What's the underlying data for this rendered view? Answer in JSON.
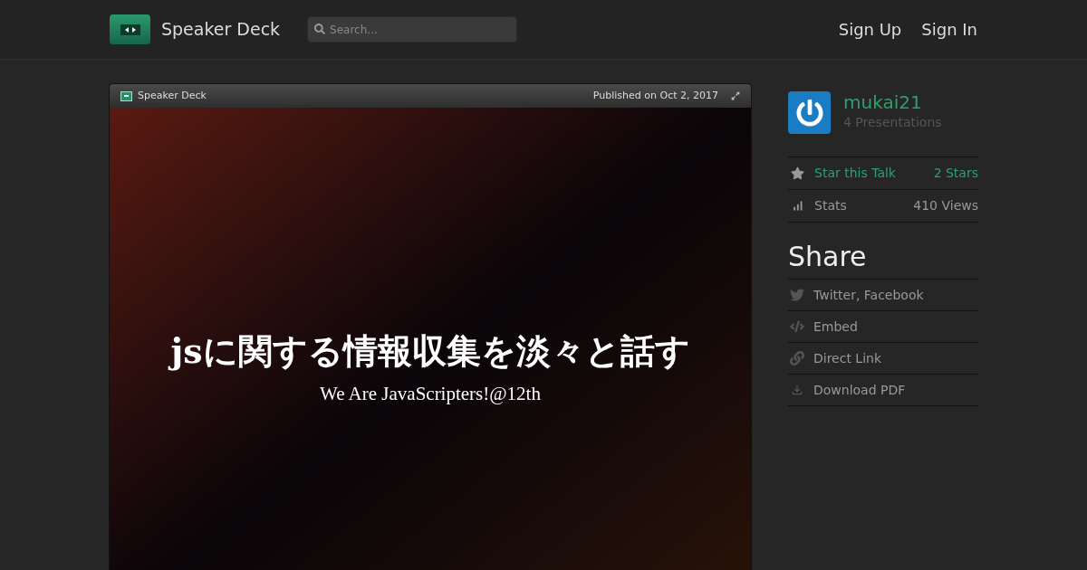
{
  "header": {
    "brand": "Speaker Deck",
    "search": {
      "placeholder": "Search..."
    },
    "nav": [
      "Sign Up",
      "Sign In"
    ]
  },
  "viewer": {
    "brand": "Speaker Deck",
    "published": "Published on Oct 2, 2017",
    "slide": {
      "title": "jsに関する情報収集を淡々と話す",
      "subtitle": "We Are JavaScripters!@12th"
    }
  },
  "sidebar": {
    "user": {
      "name": "mukai21",
      "presentations": "4 Presentations"
    },
    "actions": [
      {
        "kind": "star",
        "label": "Star this Talk",
        "value": "2 Stars"
      },
      {
        "kind": "stats",
        "label": "Stats",
        "value": "410 Views"
      }
    ],
    "share_title": "Share",
    "share": [
      {
        "kind": "bird",
        "label": "Twitter, Facebook"
      },
      {
        "kind": "code",
        "label": "Embed"
      },
      {
        "kind": "link",
        "label": "Direct Link"
      },
      {
        "kind": "download",
        "label": "Download PDF"
      }
    ]
  }
}
